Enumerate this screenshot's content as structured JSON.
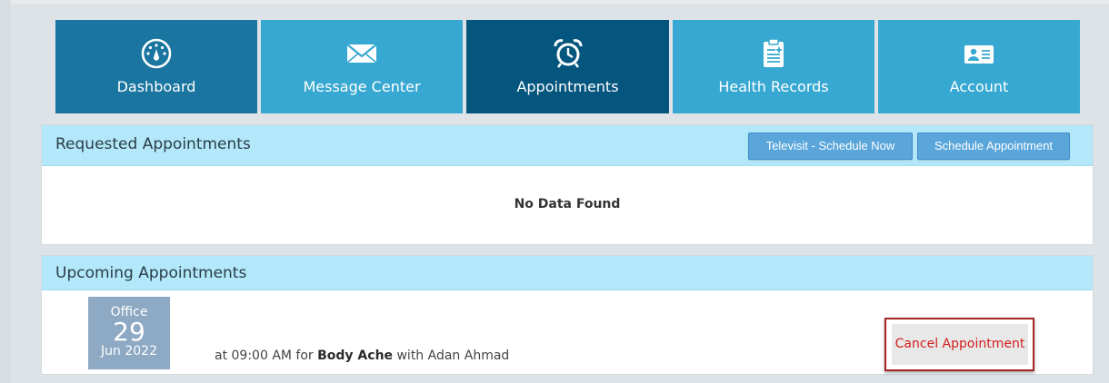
{
  "nav": {
    "tiles": [
      {
        "label": "Dashboard",
        "icon": "dashboard-gauge-icon",
        "color": "#1a75a0"
      },
      {
        "label": "Message Center",
        "icon": "envelope-icon",
        "color": "#37a8d1"
      },
      {
        "label": "Appointments",
        "icon": "alarm-clock-icon",
        "color": "#05567e",
        "active": true
      },
      {
        "label": "Health Records",
        "icon": "clipboard-icon",
        "color": "#37a8d1"
      },
      {
        "label": "Account",
        "icon": "id-card-icon",
        "color": "#37a8d1"
      }
    ]
  },
  "requested": {
    "title": "Requested Appointments",
    "televisit_label": "Televisit - Schedule Now",
    "schedule_label": "Schedule Appointment",
    "empty_message": "No Data Found"
  },
  "upcoming": {
    "title": "Upcoming Appointments",
    "appointments": [
      {
        "type": "Office",
        "day": "29",
        "month_year": "Jun 2022",
        "prefix": "at 09:00 AM for ",
        "reason": "Body Ache",
        "suffix": " with Adan Ahmad",
        "cancel_label": "Cancel Appointment"
      }
    ]
  },
  "colors": {
    "header_bar": "#b3e8fa",
    "primary_button": "#5aa6db",
    "cancel_text": "#d1201e",
    "date_badge": "#8ea9c3"
  }
}
